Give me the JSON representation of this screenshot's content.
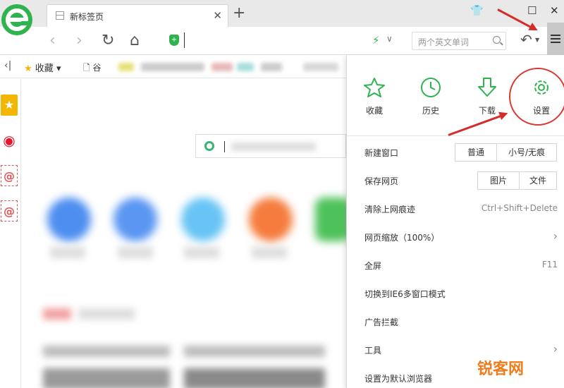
{
  "browser": {
    "tab": {
      "title": "新标签页"
    },
    "new_tab_symbol": "+",
    "tab_close_symbol": "✕",
    "window_controls": {
      "skin": "👕",
      "maximize": "☐",
      "close": "✕"
    },
    "toolbar": {
      "back": "‹",
      "forward": "›",
      "refresh": "↻",
      "home": "⌂",
      "undo": "↶"
    },
    "search": {
      "placeholder": "两个英文单词"
    },
    "bookmarks": {
      "back_symbol": "‹|",
      "favorites_label": "收藏",
      "favorites_dropdown": "▾",
      "folder_label": "谷"
    }
  },
  "menu": {
    "quick_actions": [
      {
        "label": "收藏",
        "icon": "star-icon"
      },
      {
        "label": "历史",
        "icon": "clock-icon"
      },
      {
        "label": "下载",
        "icon": "download-icon"
      },
      {
        "label": "设置",
        "icon": "gear-icon"
      }
    ],
    "items": [
      {
        "label": "新建窗口",
        "buttons": [
          "普通",
          "小号/无痕"
        ]
      },
      {
        "label": "保存网页",
        "buttons": [
          "图片",
          "文件"
        ]
      },
      {
        "label": "清除上网痕迹",
        "shortcut": "Ctrl+Shift+Delete"
      },
      {
        "label": "网页缩放（100%）",
        "has_submenu": true
      },
      {
        "label": "全屏",
        "shortcut": "F11"
      },
      {
        "label": "切换到IE6多窗口模式"
      },
      {
        "label": "广告拦截"
      },
      {
        "label": "工具",
        "has_submenu": true
      },
      {
        "label": "设置为默认浏览器"
      }
    ],
    "submenu_arrow": "›"
  },
  "watermark": "锐客网",
  "colors": {
    "accent_green": "#2fb34f",
    "annotation_red": "#d52b2b",
    "highlight_ring": "#d83a34"
  }
}
